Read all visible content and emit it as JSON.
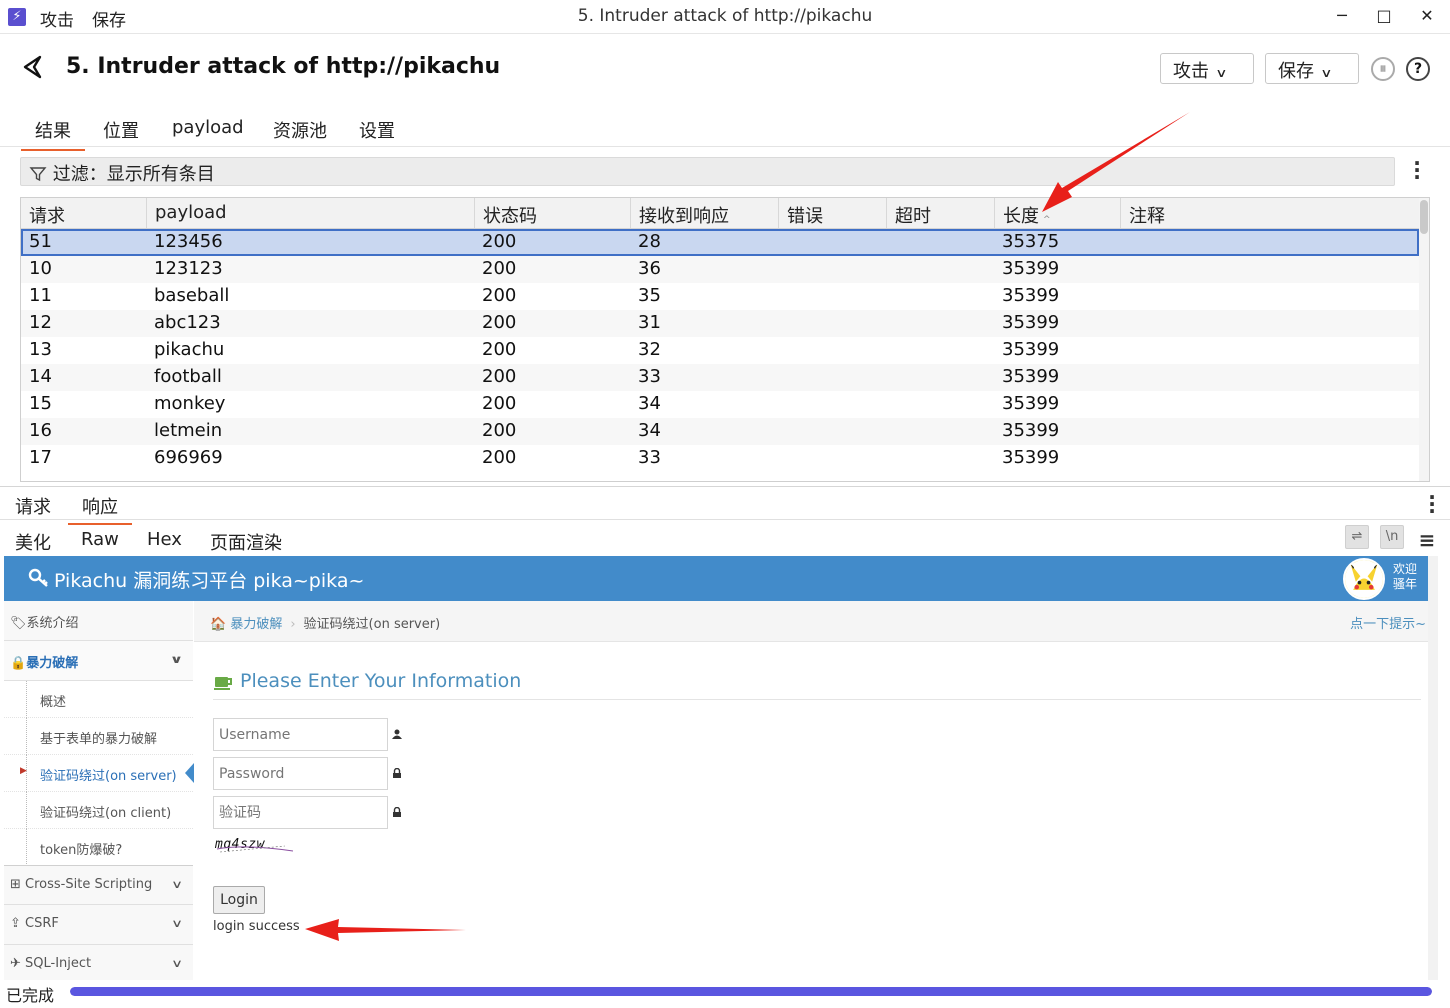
{
  "window": {
    "menu": [
      "攻击",
      "保存"
    ],
    "title": "5. Intruder attack of http://pikachu",
    "controls": [
      "─",
      "□",
      "✕"
    ]
  },
  "header": {
    "title": "5. Intruder attack of http://pikachu",
    "attack_btn": "攻击",
    "save_btn": "保存"
  },
  "tabs": [
    "结果",
    "位置",
    "payload",
    "资源池",
    "设置"
  ],
  "active_tab": "结果",
  "filter": {
    "label": "过滤：显示所有条目"
  },
  "table": {
    "columns": [
      "请求",
      "payload",
      "状态码",
      "接收到响应",
      "错误",
      "超时",
      "长度",
      "注释"
    ],
    "sorted_column": "长度",
    "rows": [
      {
        "req": "51",
        "payload": "123456",
        "status": "200",
        "resp": "28",
        "error": "",
        "timeout": "",
        "length": "35375",
        "comment": ""
      },
      {
        "req": "10",
        "payload": "123123",
        "status": "200",
        "resp": "36",
        "error": "",
        "timeout": "",
        "length": "35399",
        "comment": ""
      },
      {
        "req": "11",
        "payload": "baseball",
        "status": "200",
        "resp": "35",
        "error": "",
        "timeout": "",
        "length": "35399",
        "comment": ""
      },
      {
        "req": "12",
        "payload": "abc123",
        "status": "200",
        "resp": "31",
        "error": "",
        "timeout": "",
        "length": "35399",
        "comment": ""
      },
      {
        "req": "13",
        "payload": "pikachu",
        "status": "200",
        "resp": "32",
        "error": "",
        "timeout": "",
        "length": "35399",
        "comment": ""
      },
      {
        "req": "14",
        "payload": "football",
        "status": "200",
        "resp": "33",
        "error": "",
        "timeout": "",
        "length": "35399",
        "comment": ""
      },
      {
        "req": "15",
        "payload": "monkey",
        "status": "200",
        "resp": "34",
        "error": "",
        "timeout": "",
        "length": "35399",
        "comment": ""
      },
      {
        "req": "16",
        "payload": "letmein",
        "status": "200",
        "resp": "34",
        "error": "",
        "timeout": "",
        "length": "35399",
        "comment": ""
      },
      {
        "req": "17",
        "payload": "696969",
        "status": "200",
        "resp": "33",
        "error": "",
        "timeout": "",
        "length": "35399",
        "comment": ""
      }
    ]
  },
  "detail_tabs": [
    "请求",
    "响应"
  ],
  "active_detail_tab": "响应",
  "view_tabs": [
    "美化",
    "Raw",
    "Hex",
    "页面渲染"
  ],
  "active_view_tab": "页面渲染",
  "view_tools": [
    "wrap-icon",
    "newline-icon",
    "menu-icon"
  ],
  "newline_label": "\\n",
  "rendered_page": {
    "site_title": "Pikachu 漏洞练习平台 pika~pika~",
    "welcome": [
      "欢迎",
      "骚年"
    ],
    "sidebar": [
      {
        "label": "系统介绍",
        "icon": "tags-icon"
      },
      {
        "label": "暴力破解",
        "icon": "lock-icon",
        "open": true,
        "children": [
          {
            "label": "概述"
          },
          {
            "label": "基于表单的暴力破解"
          },
          {
            "label": "验证码绕过(on server)",
            "active": true
          },
          {
            "label": "验证码绕过(on client)"
          },
          {
            "label": "token防爆破?"
          }
        ]
      },
      {
        "label": "Cross-Site Scripting",
        "icon": "sitemap-icon"
      },
      {
        "label": "CSRF",
        "icon": "share-icon"
      },
      {
        "label": "SQL-Inject",
        "icon": "plane-icon"
      }
    ],
    "breadcrumb": {
      "link": "暴力破解",
      "current": "验证码绕过(on server)",
      "hint": "点一下提示~"
    },
    "form_title": "Please Enter Your Information",
    "username_placeholder": "Username",
    "password_placeholder": "Password",
    "captcha_placeholder": "验证码",
    "captcha_text": "mq4szw",
    "login_btn": "Login",
    "message": "login success"
  },
  "status": {
    "text": "已完成",
    "progress": 1.0,
    "progress_color": "#5a56e0"
  },
  "colors": {
    "accent_tab": "#e8602c",
    "selected_row": "#c9d7f0",
    "pikachu_header": "#428bca",
    "arrow": "#e8201a"
  }
}
